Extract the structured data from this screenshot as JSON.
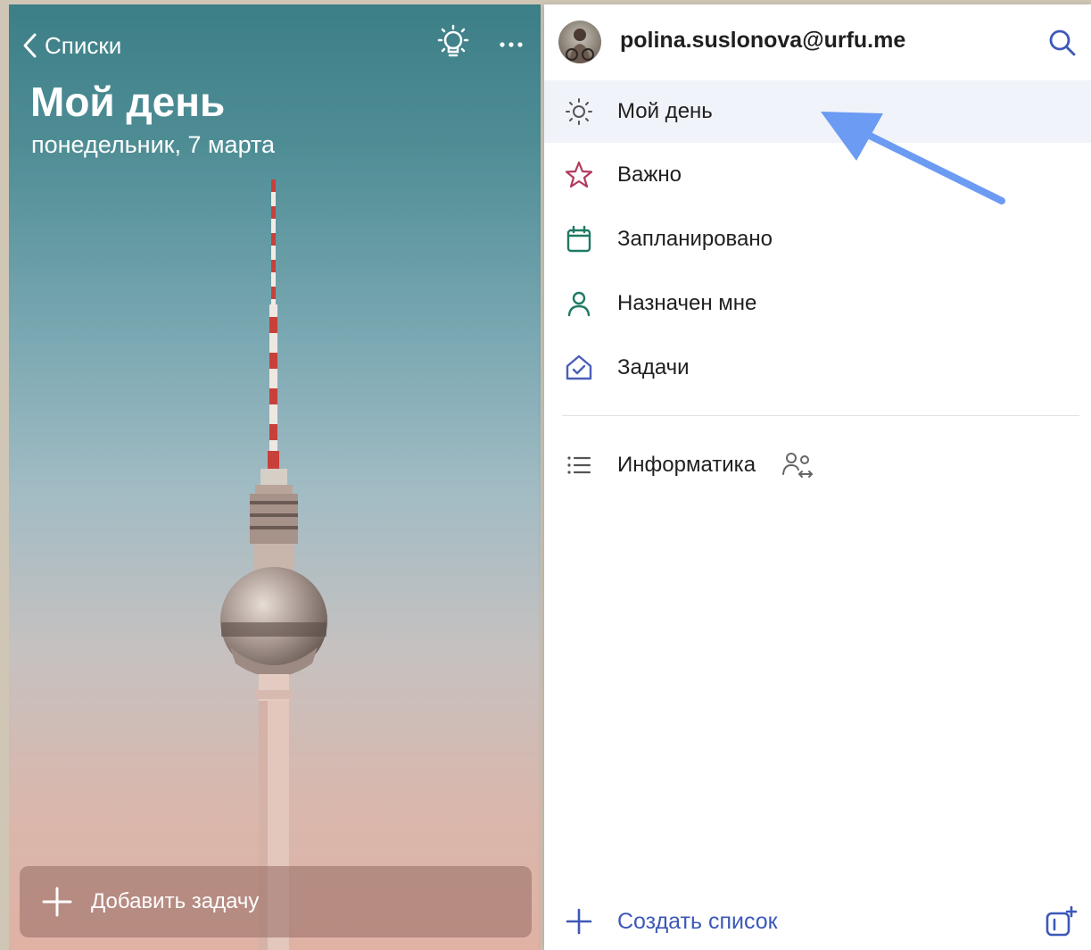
{
  "colors": {
    "accent": "#3c58b8",
    "star": "#b23a5c",
    "calendar": "#1f7a64",
    "person": "#1f7a64",
    "tasks_home": "#4a5fb8",
    "arrow": "#6b9bf2"
  },
  "left_panel": {
    "back_label": "Списки",
    "title": "Мой день",
    "date": "понедельник, 7 марта",
    "add_task_label": "Добавить задачу",
    "icons": [
      "chevron-left-icon",
      "lightbulb-icon",
      "more-icon",
      "plus-icon"
    ]
  },
  "right_panel": {
    "account_email": "polina.suslonova@urfu.me",
    "nav": [
      {
        "label": "Мой день",
        "icon": "sun-icon",
        "active": true
      },
      {
        "label": "Важно",
        "icon": "star-icon"
      },
      {
        "label": "Запланировано",
        "icon": "calendar-icon"
      },
      {
        "label": "Назначен мне",
        "icon": "person-icon"
      },
      {
        "label": "Задачи",
        "icon": "home-check-icon"
      }
    ],
    "lists": [
      {
        "label": "Информатика",
        "icon": "list-icon",
        "shared": true
      }
    ],
    "create_list_label": "Создать список"
  }
}
